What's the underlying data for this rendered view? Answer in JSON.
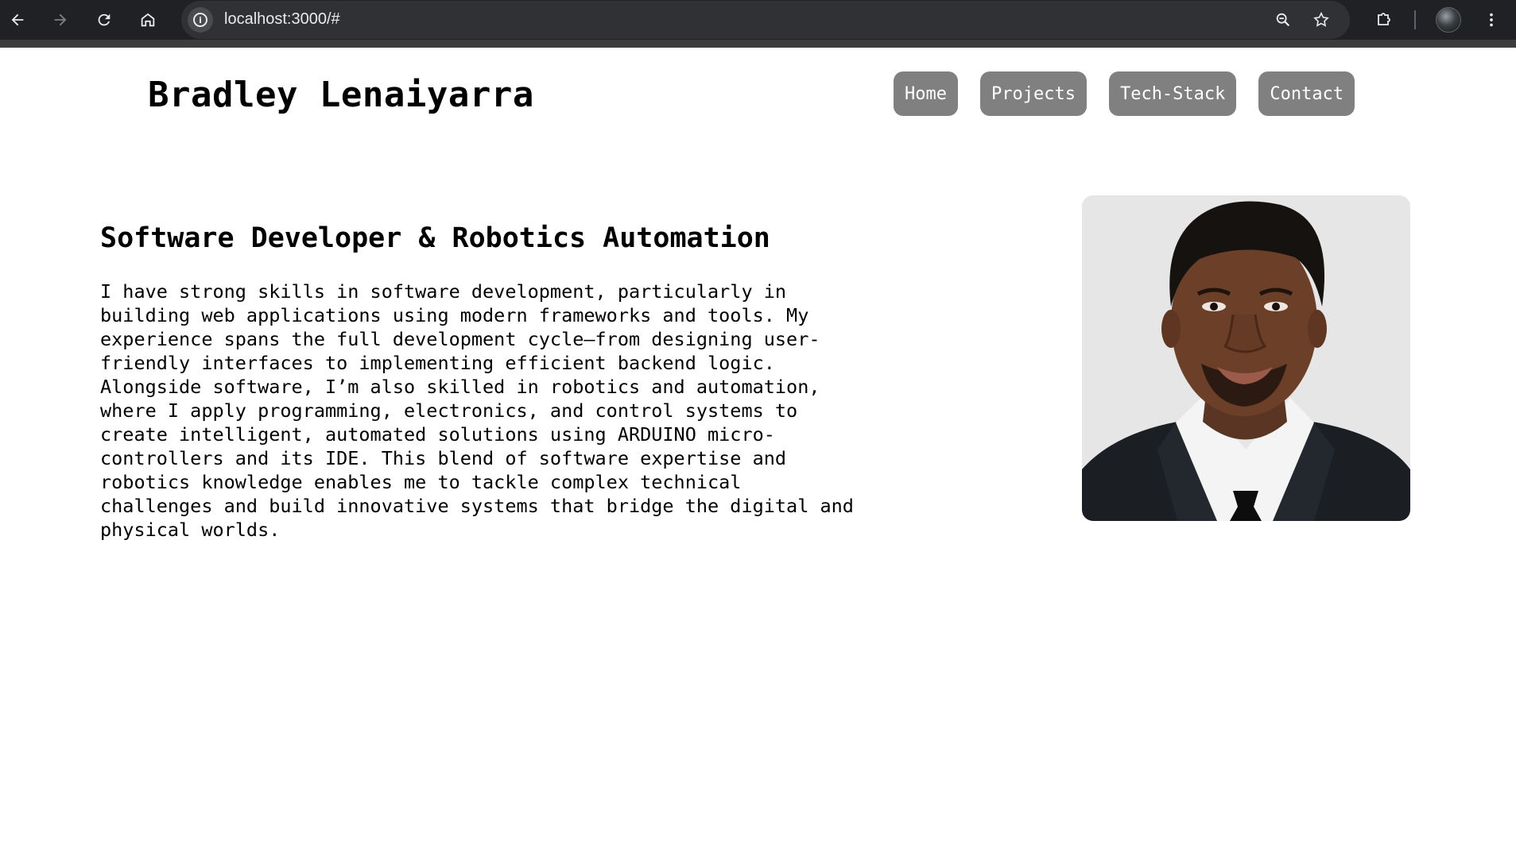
{
  "browser": {
    "url": "localhost:3000/#",
    "back_icon": "arrow-left-icon",
    "forward_icon": "arrow-right-icon",
    "reload_icon": "reload-icon",
    "home_icon": "home-icon"
  },
  "site": {
    "title": "Bradley Lenaiyarra"
  },
  "nav": {
    "items": [
      {
        "label": "Home"
      },
      {
        "label": "Projects"
      },
      {
        "label": "Tech-Stack"
      },
      {
        "label": "Contact"
      }
    ],
    "button_color": "#808080"
  },
  "hero": {
    "heading": "Software Developer & Robotics Automation",
    "paragraph": "I have strong skills in software development, particularly in building web applications using modern frameworks and tools. My experience spans the full development cycle—from designing user-friendly interfaces to implementing efficient backend logic. Alongside software, I’m also skilled in robotics and automation, where I apply programming, electronics, and control systems to create intelligent, automated solutions using ARDUINO micro-controllers and its IDE. This blend of software expertise and robotics knowledge enables me to tackle complex technical challenges and build innovative systems that bridge the digital and physical worlds."
  }
}
